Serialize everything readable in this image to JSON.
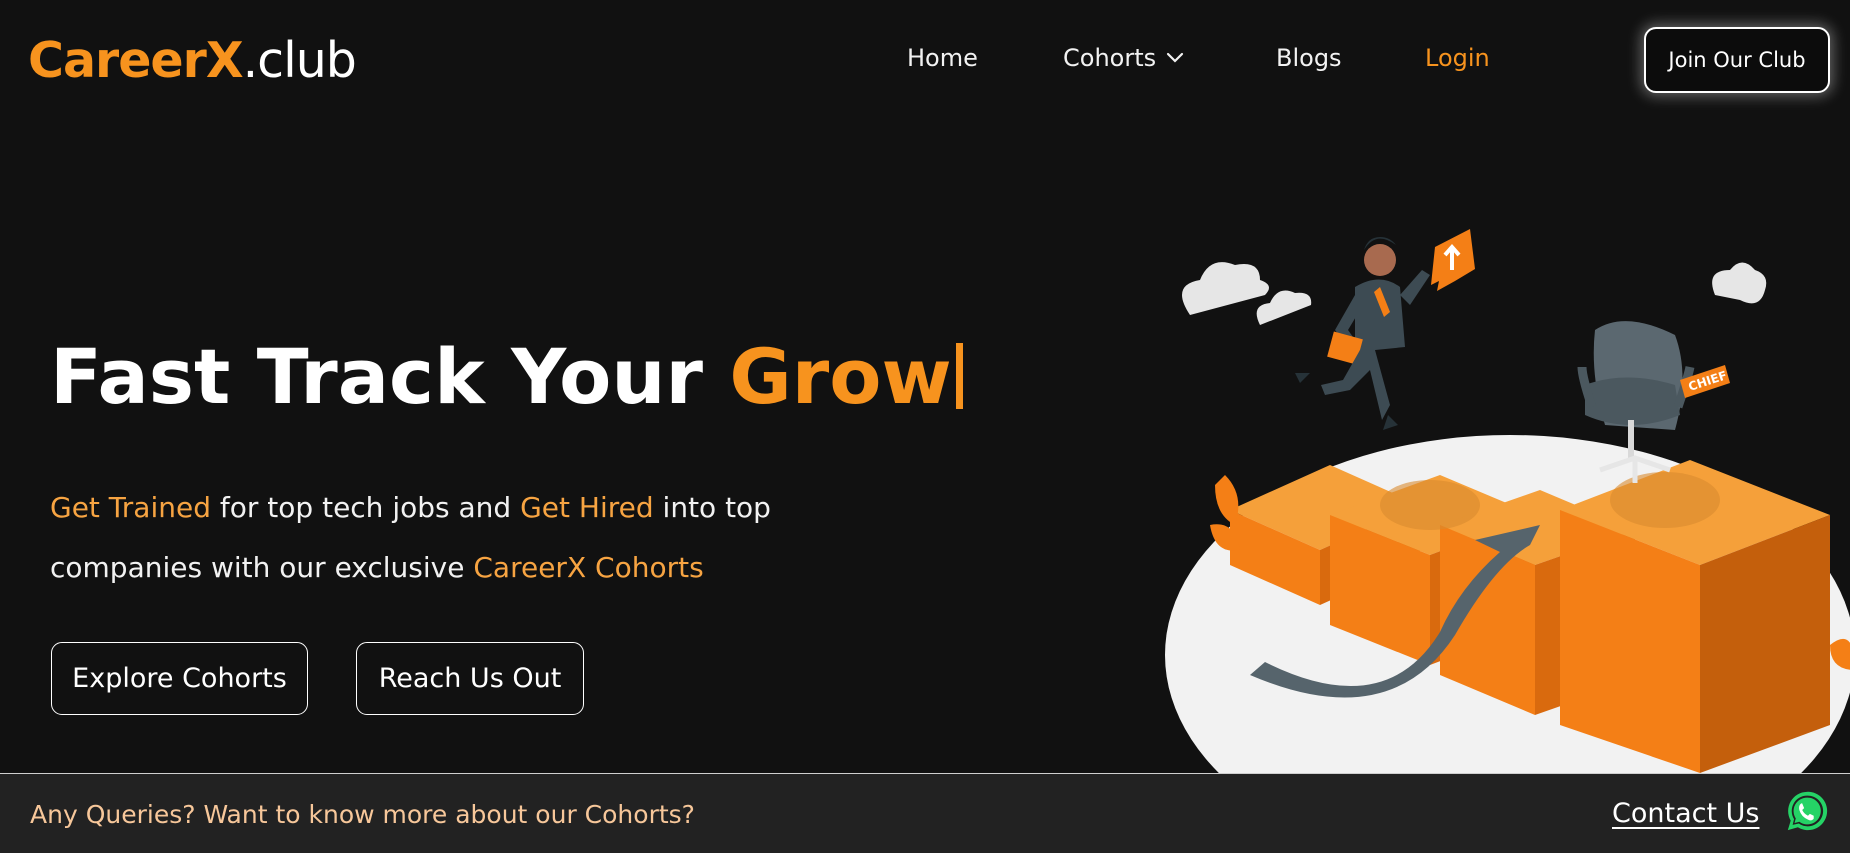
{
  "brand": {
    "part1": "Career",
    "part2": "X",
    "part3": ".club",
    "color_accent": "#f7931e"
  },
  "nav": {
    "home": "Home",
    "cohorts": "Cohorts",
    "blogs": "Blogs",
    "login": "Login",
    "join": "Join Our Club",
    "cohorts_icon": "chevron-down-icon"
  },
  "hero": {
    "title_white": "Fast Track Your ",
    "title_accent": "Grow",
    "desc": {
      "hl1": "Get Trained",
      "t1": " for top tech jobs and ",
      "hl2": "Get Hired",
      "t2": " into top companies with our exclusive ",
      "hl3": "CareerX Cohorts"
    },
    "btn_explore": "Explore Cohorts",
    "btn_reach": "Reach Us Out",
    "chair_tag": "CHIEF"
  },
  "footer_bar": {
    "query": "Any Queries? Want to know more about our Cohorts?",
    "contact": "Contact Us",
    "contact_icon": "whatsapp-icon",
    "whatsapp_color": "#25d366"
  }
}
